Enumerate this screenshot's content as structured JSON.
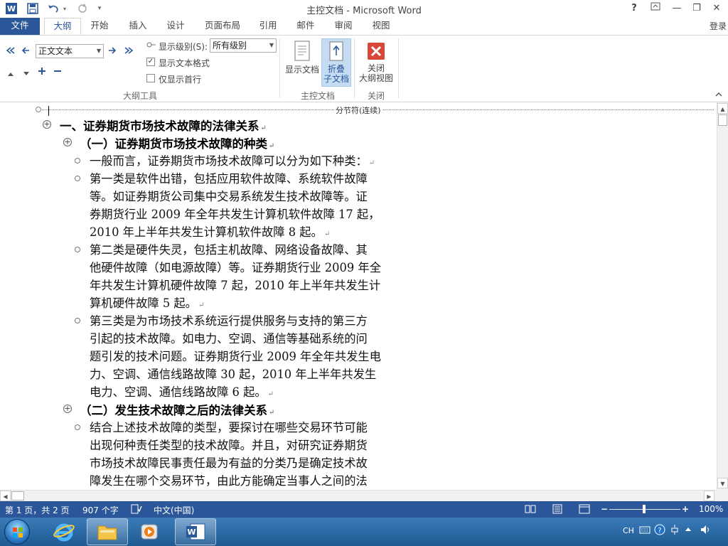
{
  "window": {
    "title": "主控文档 - Microsoft Word",
    "help": "?",
    "buttons": [
      "?",
      "⊡",
      "—",
      "❐",
      "✕"
    ]
  },
  "ribbon_tabs": [
    "文件",
    "大纲",
    "开始",
    "插入",
    "设计",
    "页面布局",
    "引用",
    "邮件",
    "审阅",
    "视图"
  ],
  "active_tab": "大纲",
  "login": "登录",
  "outline_tools": {
    "level_select": "正文文本",
    "show_level_label": "显示级别(S):",
    "show_level_value": "所有级别",
    "show_text_format": "显示文本格式",
    "show_text_format_checked": true,
    "show_first_line_only": "仅显示首行",
    "show_first_line_only_checked": false,
    "group_label": "大纲工具"
  },
  "master_document": {
    "show_document": "显示文档",
    "collapse_subdocs_line1": "折叠",
    "collapse_subdocs_line2": "子文档",
    "group_label": "主控文档"
  },
  "close_group": {
    "close_line1": "关闭",
    "close_line2": "大纲视图",
    "group_label": "关闭"
  },
  "document": {
    "section_break": "分节符(连续)",
    "heading1": "一、证券期货市场技术故障的法律关系",
    "heading2a": "（一）证券期货市场技术故障的种类",
    "para1": [
      "一般而言，证券期货市场技术故障可以分为如下种类："
    ],
    "para2": [
      "第一类是软件出错，包括应用软件故障、系统软件故障",
      "等。如证券期货公司集中交易系统发生技术故障等。证",
      "券期货行业 2009 年全年共发生计算机软件故障 17 起，",
      "2010 年上半年共发生计算机软件故障 8 起。"
    ],
    "para3": [
      "第二类是硬件失灵，包括主机故障、网络设备故障、其",
      "他硬件故障（如电源故障）等。证券期货行业 2009 年全",
      "年共发生计算机硬件故障 7 起，2010 年上半年共发生计",
      "算机硬件故障 5 起。"
    ],
    "para4": [
      "第三类是为市场技术系统运行提供服务与支持的第三方",
      "引起的技术故障。如电力、空调、通信等基础系统的问",
      "题引发的技术问题。证券期货行业 2009 年全年共发生电",
      "力、空调、通信线路故障 30 起，2010 年上半年共发生",
      "电力、空调、通信线路故障 6 起。"
    ],
    "heading2b": "（二）发生技术故障之后的法律关系",
    "para5": [
      "结合上述技术故障的类型，要探讨在哪些交易环节可能",
      "出现何种责任类型的技术故障。并且，对研究证券期货",
      "市场技术故障民事责任最为有益的分类乃是确定技术故",
      "障发生在哪个交易环节，由此方能确定当事人之间的法"
    ],
    "para_mark": "↵"
  },
  "status_bar": {
    "page": "第 1 页，共 2 页",
    "words": "907 个字",
    "language": "中文(中国)",
    "zoom": "100%",
    "zoom_minus": "−",
    "zoom_plus": "+"
  },
  "taskbar": {
    "apps": [
      "Internet Explorer",
      "Windows Explorer",
      "Media Player",
      "Microsoft Word"
    ],
    "tray_lang": "CH"
  },
  "colors": {
    "accent": "#2b579a",
    "close_red": "#d9473a"
  }
}
